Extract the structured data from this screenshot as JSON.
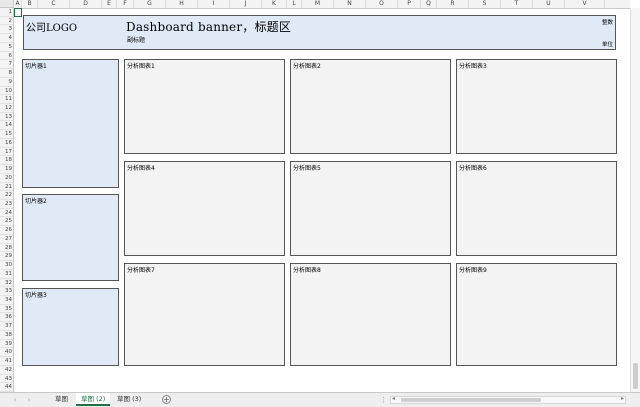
{
  "columns": [
    "A",
    "B",
    "C",
    "D",
    "E",
    "F",
    "G",
    "H",
    "I",
    "J",
    "K",
    "L",
    "M",
    "N",
    "O",
    "P",
    "Q",
    "R",
    "S",
    "T",
    "U",
    "V"
  ],
  "rows": [
    "1",
    "2",
    "3",
    "4",
    "5",
    "6",
    "7",
    "8",
    "9",
    "10",
    "11",
    "12",
    "13",
    "14",
    "15",
    "16",
    "17",
    "18",
    "19",
    "20",
    "21",
    "22",
    "23",
    "24",
    "25",
    "26",
    "27",
    "28",
    "29",
    "30",
    "31",
    "32",
    "33",
    "34",
    "35",
    "36",
    "37",
    "38",
    "39",
    "40",
    "41",
    "42",
    "43",
    "44"
  ],
  "banner": {
    "logo": "公司LOGO",
    "title": "Dashboard banner，标题区",
    "subtitle": "副标题",
    "top_right": "整数",
    "bottom_right": "单位"
  },
  "slicers": [
    "切片器1",
    "切片器2",
    "切片器3"
  ],
  "charts": [
    "分析图表1",
    "分析图表2",
    "分析图表3",
    "分析图表4",
    "分析图表5",
    "分析图表6",
    "分析图表7",
    "分析图表8",
    "分析图表9"
  ],
  "sheet_tabs": [
    {
      "label": "草图",
      "active": false
    },
    {
      "label": "草图 (2)",
      "active": true
    },
    {
      "label": "草图 (3)",
      "active": false
    }
  ],
  "nav": {
    "prev": "‹",
    "next": "›",
    "add": "+",
    "split": "⋮"
  },
  "colors": {
    "banner_bg": "#dfeaf6",
    "chart_bg": "#f3f3f3",
    "active_tab": "#217346"
  }
}
